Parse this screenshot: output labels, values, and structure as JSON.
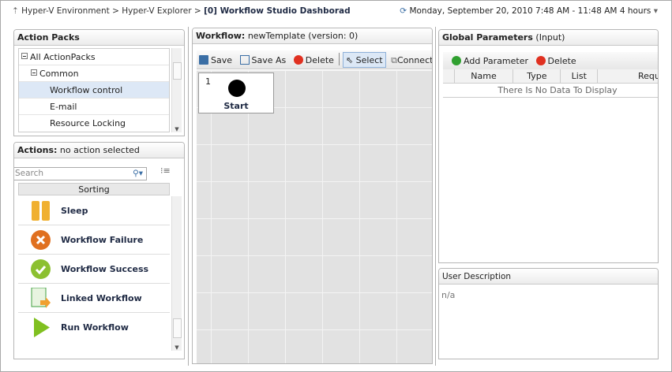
{
  "breadcrumb": {
    "items": [
      "Hyper-V Environment",
      "Hyper-V Explorer"
    ],
    "current": "[0] Workflow Studio Dashborad",
    "separator": ">"
  },
  "timerange": "Monday, September 20, 2010 7:48 AM - 11:48 AM 4 hours",
  "action_packs": {
    "title": "Action Packs",
    "items": [
      {
        "label": "All ActionPacks"
      },
      {
        "label": "Common"
      },
      {
        "label": "Workflow control",
        "selected": true
      },
      {
        "label": "E-mail"
      },
      {
        "label": "Resource Locking"
      }
    ]
  },
  "actions": {
    "title": "Actions:",
    "subtitle": "no action selected",
    "search_placeholder": "Search",
    "sort_header": "Sorting",
    "items": [
      {
        "label": "Sleep",
        "icon": "sleep-icon",
        "color": "#f0b030"
      },
      {
        "label": "Workflow Failure",
        "icon": "failure-icon",
        "color": "#e07020"
      },
      {
        "label": "Workflow Success",
        "icon": "success-icon",
        "color": "#8cc030"
      },
      {
        "label": "Linked Workflow",
        "icon": "linked-workflow-icon",
        "color": "#40a040"
      },
      {
        "label": "Run Workflow",
        "icon": "run-icon",
        "color": "#80c020"
      }
    ]
  },
  "workflow": {
    "title": "Workflow:",
    "name": "newTemplate (version: 0)",
    "toolbar": {
      "save": "Save",
      "save_as": "Save As",
      "delete": "Delete",
      "select": "Select",
      "connect": "Connect"
    },
    "node": {
      "number": "1",
      "label": "Start"
    }
  },
  "global_params": {
    "title": "Global Parameters",
    "subtitle": "(Input)",
    "add": "Add Parameter",
    "delete": "Delete",
    "columns": [
      "Name",
      "Type",
      "List",
      "Require"
    ],
    "empty": "There Is No Data To Display"
  },
  "user_description": {
    "title": "User Description",
    "value": "n/a"
  }
}
